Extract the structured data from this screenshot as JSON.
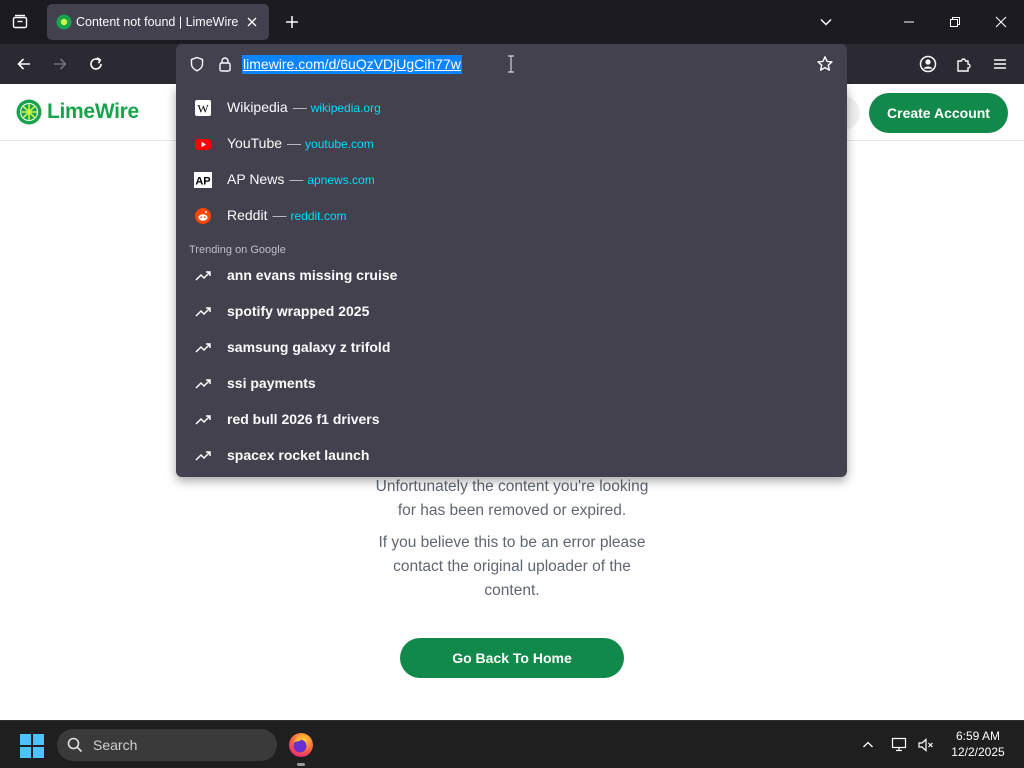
{
  "browser": {
    "tab": {
      "title": "Content not found | LimeWire",
      "favicon": "limewire-icon"
    },
    "url": "limewire.com/d/6uQzVDjUgCih77w"
  },
  "page": {
    "logo_text": "LimeWire",
    "create_account": "Create Account",
    "message_1_line1": "Unfortunately the content you're looking",
    "message_1_line2": "for has been removed or expired.",
    "message_2_line1": "If you believe this to be an error please",
    "message_2_line2": "contact the original uploader of the",
    "message_2_line3": "content.",
    "home_button": "Go Back To Home",
    "accent_color": "#11894a"
  },
  "dropdown": {
    "shortcuts": [
      {
        "name": "Wikipedia",
        "url": "wikipedia.org",
        "icon": "wikipedia-icon"
      },
      {
        "name": "YouTube",
        "url": "youtube.com",
        "icon": "youtube-icon"
      },
      {
        "name": "AP News",
        "url": "apnews.com",
        "icon": "apnews-icon"
      },
      {
        "name": "Reddit",
        "url": "reddit.com",
        "icon": "reddit-icon"
      }
    ],
    "separator": "—",
    "trending_heading": "Trending on Google",
    "trending": [
      "ann evans missing cruise",
      "spotify wrapped 2025",
      "samsung galaxy z trifold",
      "ssi payments",
      "red bull 2026 f1 drivers",
      "spacex rocket launch"
    ]
  },
  "taskbar": {
    "search_placeholder": "Search",
    "time": "6:59 AM",
    "date": "12/2/2025"
  }
}
